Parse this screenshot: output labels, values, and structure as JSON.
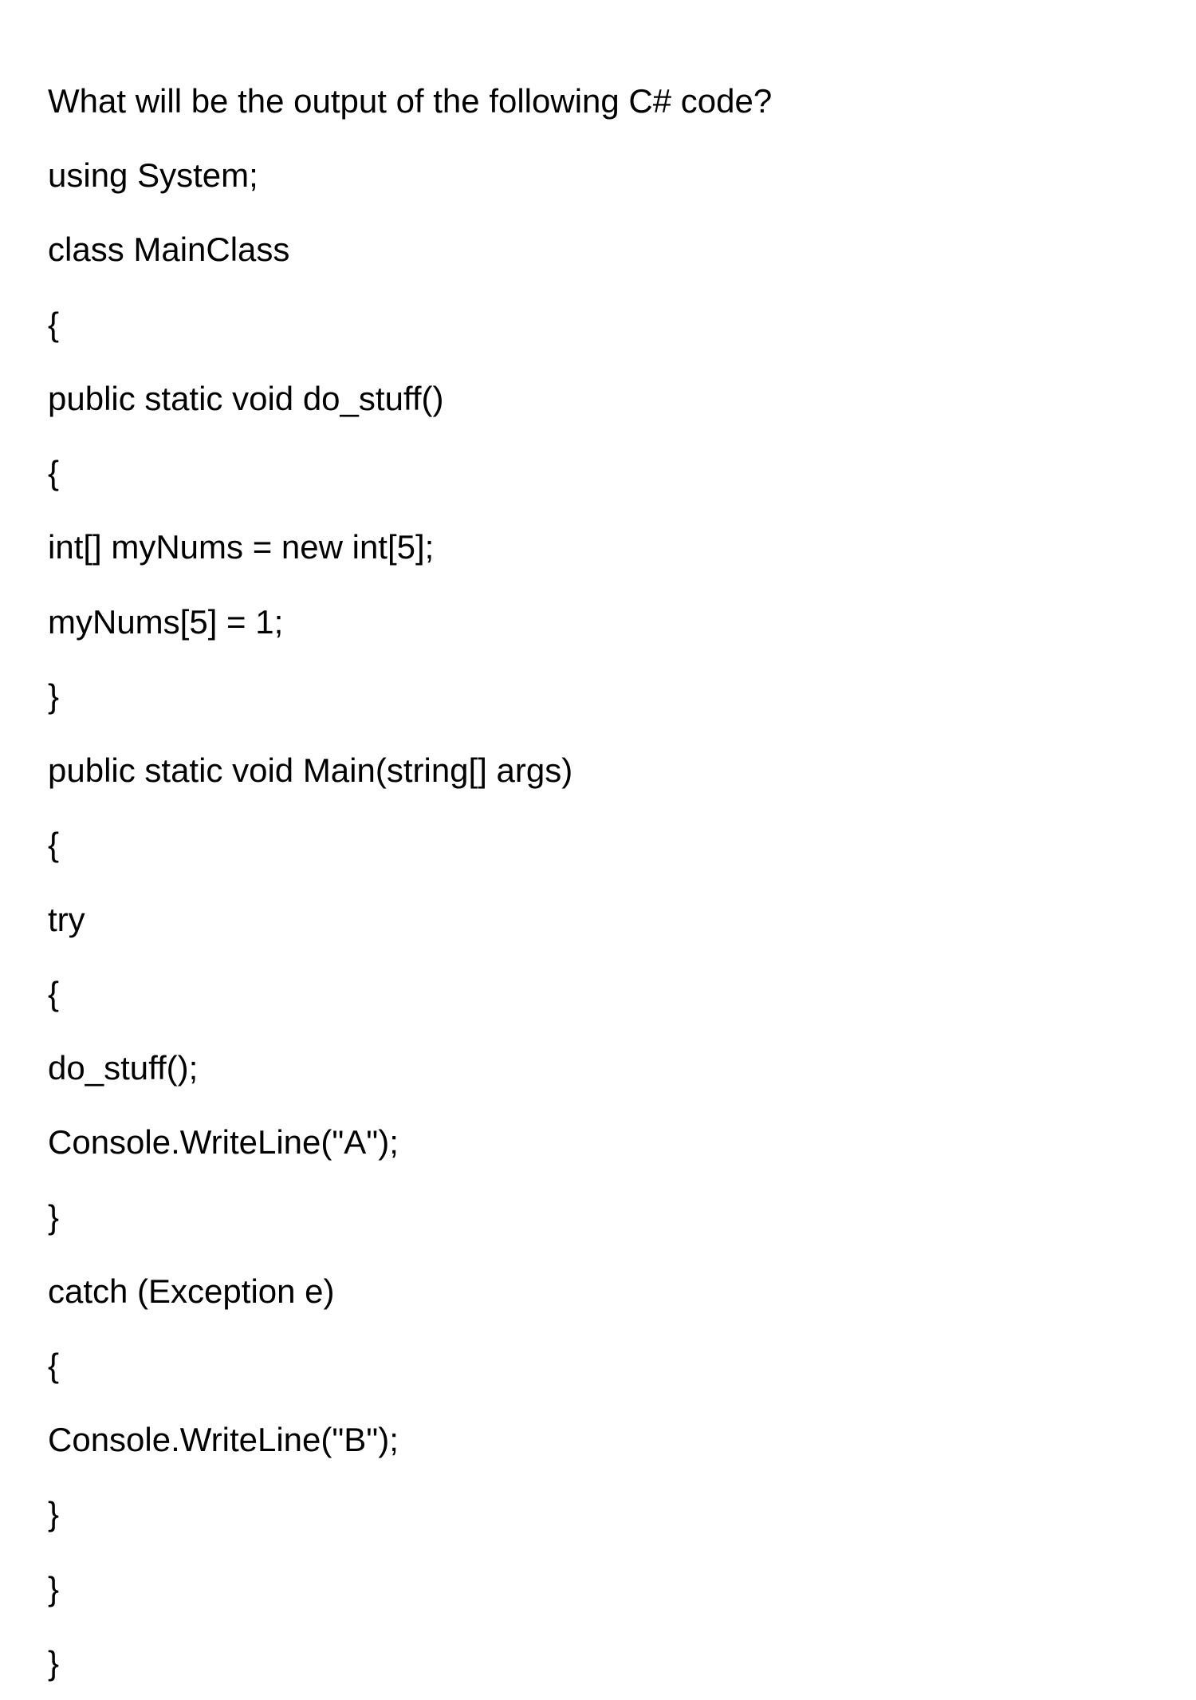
{
  "question": {
    "prompt": "What will be the output of the following C# code?",
    "code_lines": [
      "using System;",
      "class MainClass",
      "{",
      "public static void do_stuff()",
      "{",
      "int[] myNums = new int[5];",
      "myNums[5] = 1;",
      "}",
      "public static void Main(string[] args)",
      "{",
      "try",
      "{",
      "do_stuff();",
      "Console.WriteLine(\"A\");",
      "}",
      "catch (Exception e)",
      "{",
      "Console.WriteLine(\"B\");",
      "}",
      "}",
      "}"
    ]
  }
}
